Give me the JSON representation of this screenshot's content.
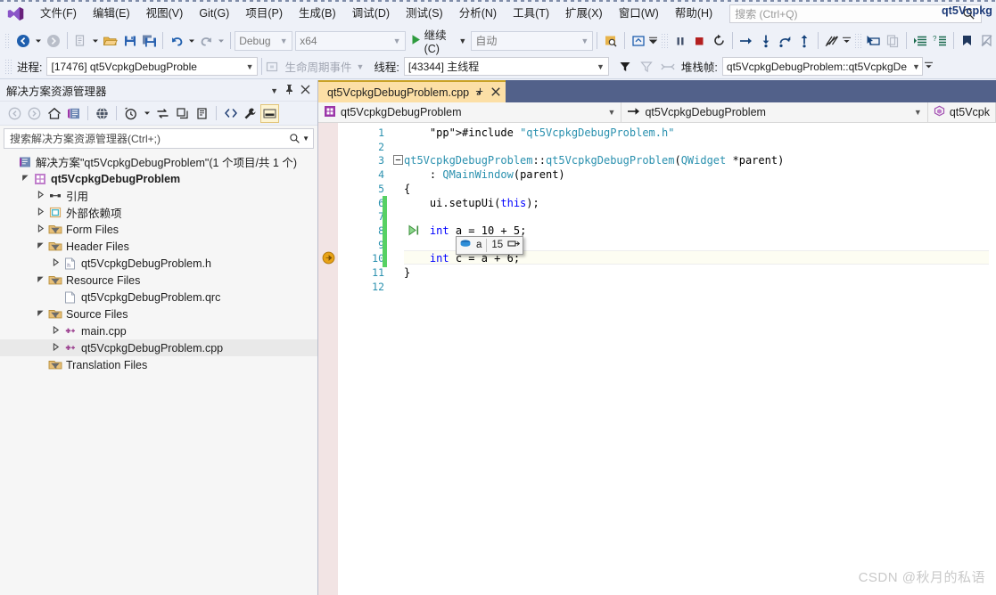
{
  "window": {
    "project_title": "qt5Vcpkg"
  },
  "menubar": {
    "logo_icon": "visual-studio-logo",
    "items": [
      "文件(F)",
      "编辑(E)",
      "视图(V)",
      "Git(G)",
      "项目(P)",
      "生成(B)",
      "调试(D)",
      "测试(S)",
      "分析(N)",
      "工具(T)",
      "扩展(X)",
      "窗口(W)",
      "帮助(H)"
    ],
    "search_placeholder": "搜索 (Ctrl+Q)",
    "search_value": "",
    "search_icon": "search-icon"
  },
  "toolbar": {
    "back_icon": "navigate-back-icon",
    "forward_icon": "navigate-forward-icon",
    "new_icon": "new-file-icon",
    "open_icon": "open-folder-icon",
    "save_icon": "save-icon",
    "save_all_icon": "save-all-icon",
    "undo_icon": "undo-icon",
    "redo_icon": "redo-icon",
    "config_value": "Debug",
    "platform_value": "x64",
    "run_label": "继续(C)",
    "run_icon": "play-icon",
    "attach_value": "自动",
    "find_icon": "find-in-files-icon",
    "home_icon": "live-share-icon",
    "pause_icon": "pause-icon",
    "stop_icon": "stop-icon",
    "restart_icon": "restart-icon",
    "step_over_icon": "step-over-icon",
    "step_into_icon": "step-into-icon",
    "step_out_icon": "step-out-icon",
    "step_return_icon": "step-return-icon",
    "hotreload_icon": "hot-reload-icon",
    "select_element_icon": "select-element-icon",
    "copy_icon": "copy-icon",
    "indent_icon": "indent-icon",
    "indent2_icon": "comment-icon",
    "bookmark_icon": "bookmark-icon",
    "bookmark_clear_icon": "bookmark-clear-icon"
  },
  "debugbar": {
    "process_label": "进程:",
    "process_value": "[17476] qt5VcpkgDebugProble",
    "lifecycle_icon": "lifecycle-icon",
    "lifecycle_label": "生命周期事件",
    "thread_label": "线程:",
    "thread_value": "[43344] 主线程",
    "filter_icon": "filter-icon",
    "filter2_icon": "filter-clear-icon",
    "threads_icon": "threads-icon",
    "stackframe_label": "堆栈帧:",
    "stackframe_value": "qt5VcpkgDebugProblem::qt5VcpkgDe"
  },
  "solution_explorer": {
    "title": "解决方案资源管理器",
    "dropdown_icon": "chevron-down-icon",
    "pin_icon": "pin-icon",
    "close_icon": "close-icon",
    "tools": [
      {
        "name": "nav-back-icon",
        "glyph": "back"
      },
      {
        "name": "nav-forward-icon",
        "glyph": "forward"
      },
      {
        "name": "home-icon",
        "glyph": "home"
      },
      {
        "name": "solution-explorer-icon",
        "glyph": "solexp"
      },
      {
        "name": "global-icon",
        "glyph": "globe"
      },
      {
        "name": "pending-changes-icon",
        "glyph": "clock"
      },
      {
        "name": "sync-icon",
        "glyph": "sync"
      },
      {
        "name": "collapse-all-icon",
        "glyph": "collapse"
      },
      {
        "name": "properties-icon",
        "glyph": "props"
      },
      {
        "name": "show-all-files-icon",
        "glyph": "code"
      },
      {
        "name": "settings-icon",
        "glyph": "wrench"
      },
      {
        "name": "preview-icon",
        "glyph": "preview"
      }
    ],
    "search_placeholder": "搜索解决方案资源管理器(Ctrl+;)",
    "search_value": "",
    "search_icon": "search-icon",
    "tree": [
      {
        "label": "解决方案\"qt5VcpkgDebugProblem\"(1 个项目/共 1 个)",
        "indent": 0,
        "twisty": "",
        "icon": "solution-icon",
        "bold": false,
        "selected": false
      },
      {
        "label": "qt5VcpkgDebugProblem",
        "indent": 1,
        "twisty": "open",
        "icon": "project-icon",
        "bold": true,
        "selected": false
      },
      {
        "label": "引用",
        "indent": 2,
        "twisty": "closed",
        "icon": "references-icon",
        "bold": false,
        "selected": false
      },
      {
        "label": "外部依赖项",
        "indent": 2,
        "twisty": "closed",
        "icon": "external-deps-icon",
        "bold": false,
        "selected": false
      },
      {
        "label": "Form Files",
        "indent": 2,
        "twisty": "closed",
        "icon": "filter-folder-icon",
        "bold": false,
        "selected": false
      },
      {
        "label": "Header Files",
        "indent": 2,
        "twisty": "open",
        "icon": "filter-folder-icon",
        "bold": false,
        "selected": false
      },
      {
        "label": "qt5VcpkgDebugProblem.h",
        "indent": 3,
        "twisty": "closed",
        "icon": "header-file-icon",
        "bold": false,
        "selected": false
      },
      {
        "label": "Resource Files",
        "indent": 2,
        "twisty": "open",
        "icon": "filter-folder-icon",
        "bold": false,
        "selected": false
      },
      {
        "label": "qt5VcpkgDebugProblem.qrc",
        "indent": 3,
        "twisty": "",
        "icon": "generic-file-icon",
        "bold": false,
        "selected": false
      },
      {
        "label": "Source Files",
        "indent": 2,
        "twisty": "open",
        "icon": "filter-folder-icon",
        "bold": false,
        "selected": false
      },
      {
        "label": "main.cpp",
        "indent": 3,
        "twisty": "closed",
        "icon": "cpp-file-icon",
        "bold": false,
        "selected": false
      },
      {
        "label": "qt5VcpkgDebugProblem.cpp",
        "indent": 3,
        "twisty": "closed",
        "icon": "cpp-file-icon",
        "bold": false,
        "selected": true
      },
      {
        "label": "Translation Files",
        "indent": 2,
        "twisty": "",
        "icon": "filter-folder-icon",
        "bold": false,
        "selected": false
      }
    ]
  },
  "editor": {
    "tab_label": "qt5VcpkgDebugProblem.cpp",
    "tab_pin_icon": "pin-icon",
    "tab_close_icon": "close-icon",
    "nav_project": "qt5VcpkgDebugProblem",
    "nav_project_icon": "project-icon",
    "nav_scope": "qt5VcpkgDebugProblem",
    "nav_scope_icon": "arrow-right-icon",
    "nav_member": "qt5Vcpk",
    "nav_member_icon": "method-icon",
    "lines": [
      {
        "n": 1,
        "text": "    #include \"qt5VcpkgDebugProblem.h\""
      },
      {
        "n": 2,
        "text": ""
      },
      {
        "n": 3,
        "text": "qt5VcpkgDebugProblem::qt5VcpkgDebugProblem(QWidget *parent)"
      },
      {
        "n": 4,
        "text": "    : QMainWindow(parent)"
      },
      {
        "n": 5,
        "text": "{"
      },
      {
        "n": 6,
        "text": "    ui.setupUi(this);"
      },
      {
        "n": 7,
        "text": ""
      },
      {
        "n": 8,
        "text": "    int a = 10 + 5;"
      },
      {
        "n": 9,
        "text": ""
      },
      {
        "n": 10,
        "text": "    int c = a + 6;"
      },
      {
        "n": 11,
        "text": "}"
      },
      {
        "n": 12,
        "text": ""
      }
    ],
    "breakpoint_line": 10,
    "breakpoint_icon": "breakpoint-current-icon",
    "current_statement_icon": "current-statement-arrow-icon",
    "fold_icon": "collapse-minus-icon",
    "datatip": {
      "var_icon": "variable-icon",
      "name": "a",
      "value": "15",
      "pin_icon": "pin-to-source-icon"
    }
  },
  "watermark": "CSDN @秋月的私语",
  "colors": {
    "chrome": "#eef1f8",
    "tab_active": "#fcdfa6",
    "tabstrip": "#52618a",
    "accent_blue": "#1c3a78",
    "changed_line": "#57d163",
    "breakpoint": "#e8a317",
    "keyword": "#0000ff",
    "string": "#a31515",
    "type": "#2b91af",
    "preprocessor": "#808080"
  }
}
